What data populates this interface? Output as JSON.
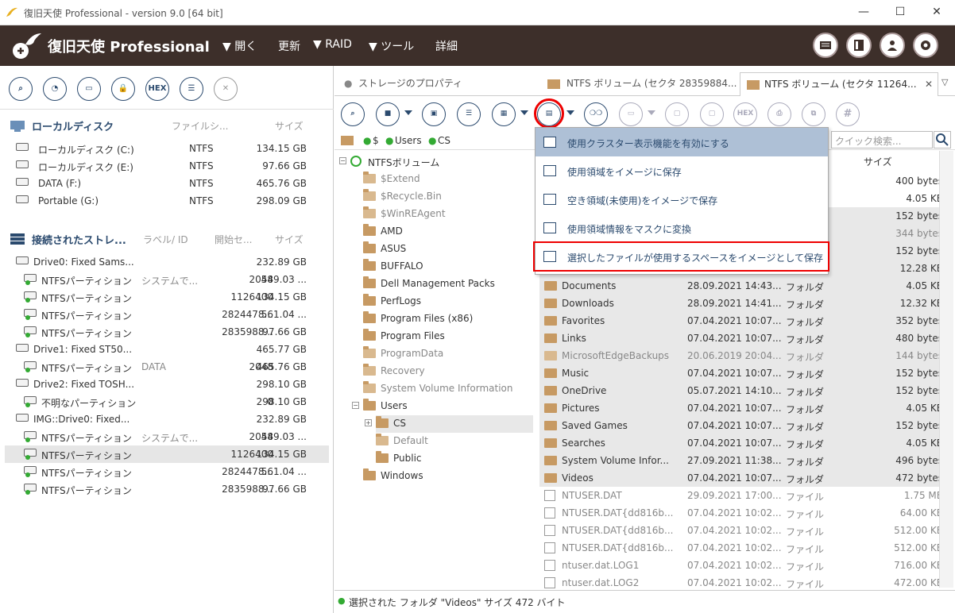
{
  "window": {
    "title": "復旧天使 Professional - version 9.0 [64 bit]",
    "min": "—",
    "max": "☐",
    "close": "✕"
  },
  "header": {
    "brand": "復旧天使 Professional",
    "menu": [
      "▼ 開く",
      "更新",
      "▼ RAID",
      "▼ ツール",
      "詳細"
    ]
  },
  "left": {
    "tool_hex": "HEX",
    "local": {
      "title": "ローカルディスク",
      "col_fs": "ファイルシ...",
      "col_size": "サイズ",
      "items": [
        {
          "name": "ローカルディスク (C:)",
          "fs": "NTFS",
          "size": "134.15 GB"
        },
        {
          "name": "ローカルディスク (E:)",
          "fs": "NTFS",
          "size": "97.66 GB"
        },
        {
          "name": "DATA (F:)",
          "fs": "NTFS",
          "size": "465.76 GB"
        },
        {
          "name": "Portable (G:)",
          "fs": "NTFS",
          "size": "298.09 GB"
        }
      ]
    },
    "connected": {
      "title": "接続されたストレ...",
      "col_label": "ラベル/ ID",
      "col_start": "開始セ...",
      "col_size": "サイズ",
      "items": [
        {
          "type": "drive",
          "name": "Drive0: Fixed Sams...",
          "label": "",
          "start": "",
          "size": "232.89 GB"
        },
        {
          "type": "part",
          "name": "NTFSパーティション",
          "label": "システムで...",
          "start": "2048",
          "size": "549.03 ..."
        },
        {
          "type": "part",
          "name": "NTFSパーティション",
          "label": "",
          "start": "1126400",
          "size": "134.15 GB"
        },
        {
          "type": "part",
          "name": "NTFSパーティション",
          "label": "",
          "start": "2824478...",
          "size": "561.04 ..."
        },
        {
          "type": "part",
          "name": "NTFSパーティション",
          "label": "",
          "start": "2835988...",
          "size": "97.66 GB"
        },
        {
          "type": "drive",
          "name": "Drive1: Fixed ST50...",
          "label": "",
          "start": "",
          "size": "465.77 GB"
        },
        {
          "type": "part",
          "name": "NTFSパーティション",
          "label": "DATA",
          "start": "2048",
          "size": "465.76 GB"
        },
        {
          "type": "drive",
          "name": "Drive2: Fixed TOSH...",
          "label": "",
          "start": "",
          "size": "298.10 GB"
        },
        {
          "type": "part",
          "name": "不明なパーティション",
          "label": "",
          "start": "0",
          "size": "298.10 GB"
        },
        {
          "type": "drive",
          "name": "IMG::Drive0: Fixed...",
          "label": "",
          "start": "",
          "size": "232.89 GB"
        },
        {
          "type": "part",
          "name": "NTFSパーティション",
          "label": "システムで...",
          "start": "2048",
          "size": "549.03 ..."
        },
        {
          "type": "part",
          "name": "NTFSパーティション",
          "label": "",
          "start": "1126400",
          "size": "134.15 GB",
          "selected": true
        },
        {
          "type": "part",
          "name": "NTFSパーティション",
          "label": "",
          "start": "2824478...",
          "size": "561.04 ..."
        },
        {
          "type": "part",
          "name": "NTFSパーティション",
          "label": "",
          "start": "2835988...",
          "size": "97.66 GB"
        }
      ]
    }
  },
  "tabs": [
    "ストレージのプロパティ",
    "NTFS ボリューム (セクタ 28359884...",
    "NTFS ボリューム (セクタ 11264..."
  ],
  "tab_close": "✕",
  "toolbar": {
    "hex": "HEX",
    "hash": "#"
  },
  "breadcrumb": [
    "$",
    "Users",
    "CS"
  ],
  "search": {
    "placeholder": "クイック検索..."
  },
  "tree": [
    {
      "label": "NTFSボリューム",
      "level": 0,
      "root": true
    },
    {
      "label": "$Extend",
      "level": 1,
      "gray": true
    },
    {
      "label": "$Recycle.Bin",
      "level": 1,
      "gray": true
    },
    {
      "label": "$WinREAgent",
      "level": 1,
      "gray": true
    },
    {
      "label": "AMD",
      "level": 1
    },
    {
      "label": "ASUS",
      "level": 1
    },
    {
      "label": "BUFFALO",
      "level": 1
    },
    {
      "label": "Dell Management Packs",
      "level": 1
    },
    {
      "label": "PerfLogs",
      "level": 1
    },
    {
      "label": "Program Files (x86)",
      "level": 1
    },
    {
      "label": "Program Files",
      "level": 1
    },
    {
      "label": "ProgramData",
      "level": 1,
      "gray": true
    },
    {
      "label": "Recovery",
      "level": 1,
      "gray": true
    },
    {
      "label": "System Volume Information",
      "level": 1,
      "gray": true
    },
    {
      "label": "Users",
      "level": 1
    },
    {
      "label": "CS",
      "level": 2,
      "selected": true
    },
    {
      "label": "Default",
      "level": 2,
      "gray": true
    },
    {
      "label": "Public",
      "level": 2
    },
    {
      "label": "Windows",
      "level": 1
    }
  ],
  "list": {
    "col_size": "サイズ",
    "rows": [
      {
        "name": "",
        "date": "",
        "type": "",
        "size": "400 bytes"
      },
      {
        "name": "",
        "date": "",
        "type": "",
        "size": "4.05 KB"
      },
      {
        "name": "",
        "date": "",
        "type": "",
        "size": "152 bytes",
        "shade": true
      },
      {
        "name": "",
        "date": "",
        "type": "",
        "size": "344 bytes",
        "shade": true,
        "gray": true
      },
      {
        "name": "",
        "date": "",
        "type": "",
        "size": "152 bytes",
        "shade": true
      },
      {
        "name": "",
        "date": "",
        "type": "",
        "size": "12.28 KB",
        "shade": true
      },
      {
        "name": "Documents",
        "date": "28.09.2021 14:43...",
        "type": "フォルダ",
        "size": "4.05 KB",
        "shade": true,
        "folder": true
      },
      {
        "name": "Downloads",
        "date": "28.09.2021 14:41...",
        "type": "フォルダ",
        "size": "12.32 KB",
        "shade": true,
        "folder": true
      },
      {
        "name": "Favorites",
        "date": "07.04.2021 10:07...",
        "type": "フォルダ",
        "size": "352 bytes",
        "shade": true,
        "folder": true
      },
      {
        "name": "Links",
        "date": "07.04.2021 10:07...",
        "type": "フォルダ",
        "size": "480 bytes",
        "shade": true,
        "folder": true
      },
      {
        "name": "MicrosoftEdgeBackups",
        "date": "20.06.2019 20:04...",
        "type": "フォルダ",
        "size": "144 bytes",
        "shade": true,
        "folder": true,
        "gray": true
      },
      {
        "name": "Music",
        "date": "07.04.2021 10:07...",
        "type": "フォルダ",
        "size": "152 bytes",
        "shade": true,
        "folder": true
      },
      {
        "name": "OneDrive",
        "date": "05.07.2021 14:10...",
        "type": "フォルダ",
        "size": "152 bytes",
        "shade": true,
        "folder": true
      },
      {
        "name": "Pictures",
        "date": "07.04.2021 10:07...",
        "type": "フォルダ",
        "size": "4.05 KB",
        "shade": true,
        "folder": true
      },
      {
        "name": "Saved Games",
        "date": "07.04.2021 10:07...",
        "type": "フォルダ",
        "size": "152 bytes",
        "shade": true,
        "folder": true
      },
      {
        "name": "Searches",
        "date": "07.04.2021 10:07...",
        "type": "フォルダ",
        "size": "4.05 KB",
        "shade": true,
        "folder": true
      },
      {
        "name": "System Volume Infor...",
        "date": "27.09.2021 11:38...",
        "type": "フォルダ",
        "size": "496 bytes",
        "shade": true,
        "folder": true
      },
      {
        "name": "Videos",
        "date": "07.04.2021 10:07...",
        "type": "フォルダ",
        "size": "472 bytes",
        "shade": true,
        "folder": true
      },
      {
        "name": "NTUSER.DAT",
        "date": "29.09.2021 17:00...",
        "type": "ファイル",
        "size": "1.75 MB",
        "gray": true
      },
      {
        "name": "NTUSER.DAT{dd816b...",
        "date": "07.04.2021 10:02...",
        "type": "ファイル",
        "size": "64.00 KB",
        "gray": true
      },
      {
        "name": "NTUSER.DAT{dd816b...",
        "date": "07.04.2021 10:02...",
        "type": "ファイル",
        "size": "512.00 KB",
        "gray": true
      },
      {
        "name": "NTUSER.DAT{dd816b...",
        "date": "07.04.2021 10:02...",
        "type": "ファイル",
        "size": "512.00 KB",
        "gray": true
      },
      {
        "name": "ntuser.dat.LOG1",
        "date": "07.04.2021 10:02...",
        "type": "ファイル",
        "size": "716.00 KB",
        "gray": true
      },
      {
        "name": "ntuser.dat.LOG2",
        "date": "07.04.2021 10:02...",
        "type": "ファイル",
        "size": "472.00 KB",
        "gray": true
      }
    ]
  },
  "status": "選択された フォルダ \"Videos\" サイズ 472 バイト",
  "dropdown": [
    "使用クラスター表示機能を有効にする",
    "使用領域をイメージに保存",
    "空き領域(未使用)をイメージで保存",
    "使用領域情報をマスクに変換",
    "選択したファイルが使用するスペースをイメージとして保存"
  ],
  "colors": {
    "header_bg": "#3d2f2a",
    "accent": "#2b4a6e",
    "highlight": "#aec0d6",
    "red": "#e00000",
    "folder": "#c79a63"
  }
}
